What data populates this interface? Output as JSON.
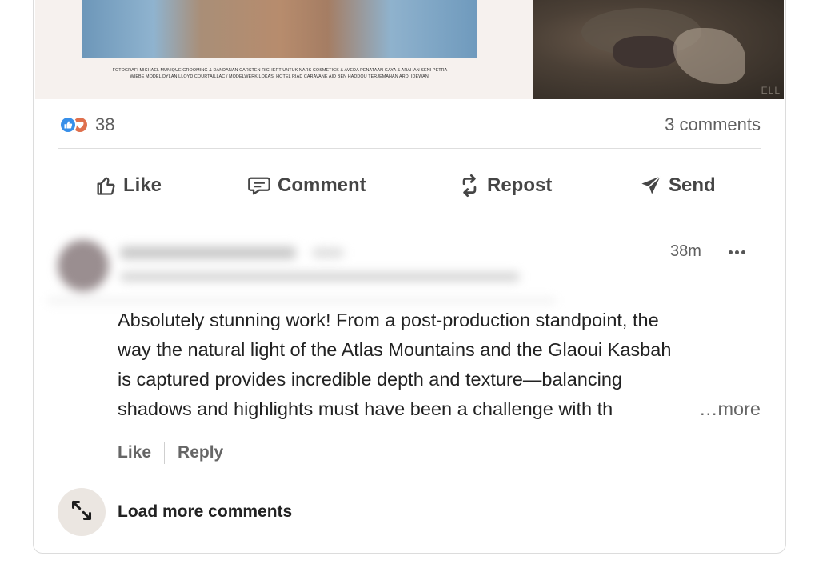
{
  "post_image": {
    "credits_line1": "FOTOGRAFI MICHAEL MUNIQUE GROOMING & DANDANAN CARSTEN RICHERT UNTUK NARS COSMETICS & AVEDA PENATAAN GAYA & ARAHAN SENI PETRA",
    "credits_line2": "WIEBE MODEL DYLAN LLOYD COURTAILLAC / MODELWERK LOKASI HOTEL RIAD CARAVANE AID BEN HADDOU TERJEMAHAN ARDI IDEWANI",
    "watermark": "ELL"
  },
  "social": {
    "reaction_icons": [
      "like-icon",
      "love-icon"
    ],
    "reaction_count": "38",
    "comments_count": "3 comments"
  },
  "actions": {
    "like": "Like",
    "comment": "Comment",
    "repost": "Repost",
    "send": "Send"
  },
  "comment": {
    "time": "38m",
    "lines": [
      "Absolutely stunning work! From a post-production standpoint, the",
      "way the natural light of the Atlas Mountains and the Glaoui Kasbah",
      "is captured provides incredible depth and texture—balancing",
      "shadows and highlights must have been a challenge with th"
    ],
    "see_more": "…more",
    "like_label": "Like",
    "reply_label": "Reply"
  },
  "load_more": {
    "label": "Load more comments",
    "icon": "expand-icon"
  },
  "colors": {
    "like_blue": "#378fe9",
    "love_orange": "#df704d",
    "text_gray": "#5f5f5f"
  }
}
